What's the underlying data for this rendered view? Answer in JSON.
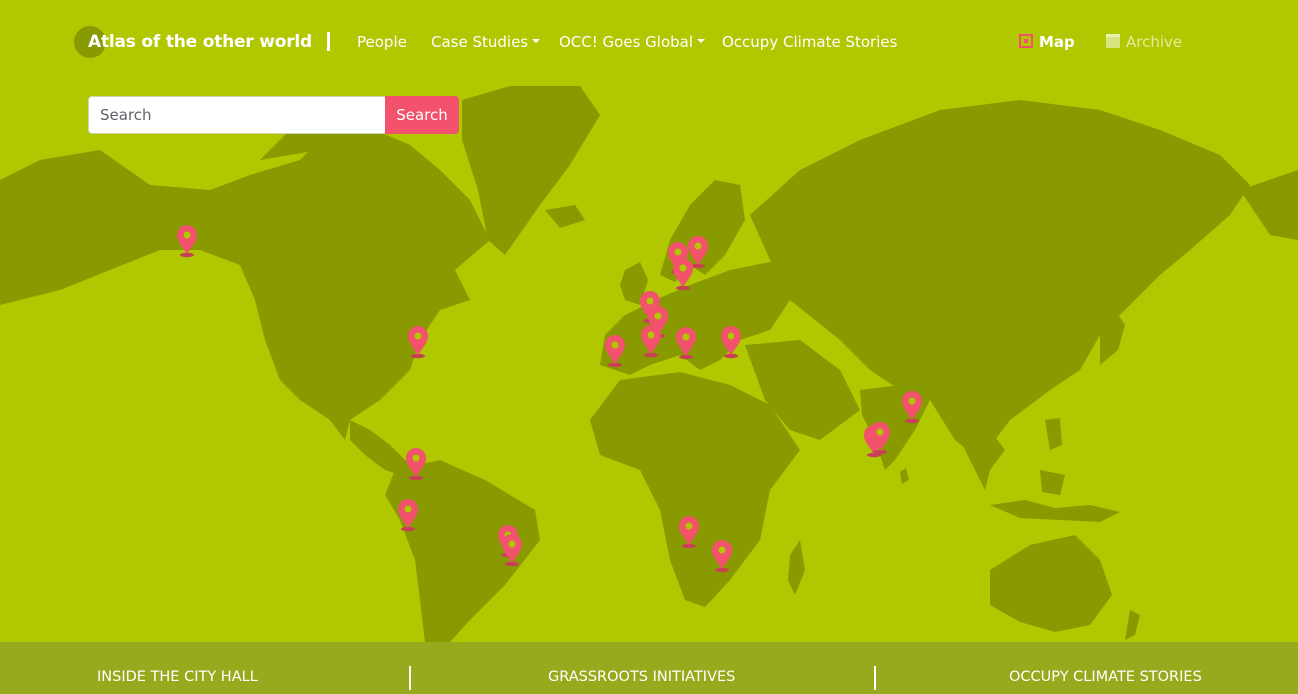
{
  "brand": {
    "title": "Atlas of the other world"
  },
  "nav": {
    "people": "People",
    "case_studies": "Case Studies",
    "occ_goes_global": "OCC! Goes Global",
    "occupy_climate_stories": "Occupy Climate Stories",
    "map": "Map",
    "archive": "Archive"
  },
  "search": {
    "placeholder": "Search",
    "button_label": "Search"
  },
  "footer": {
    "links": [
      "INSIDE THE CITY HALL",
      "GRASSROOTS INITIATIVES",
      "OCCUPY CLIMATE STORIES"
    ]
  },
  "colors": {
    "background": "#b1c700",
    "land": "#889a00",
    "accent": "#f2526b",
    "footer": "#97aa1d"
  },
  "icons": {
    "map": "map-icon",
    "archive": "archive-icon",
    "marker": "map-marker-icon"
  }
}
